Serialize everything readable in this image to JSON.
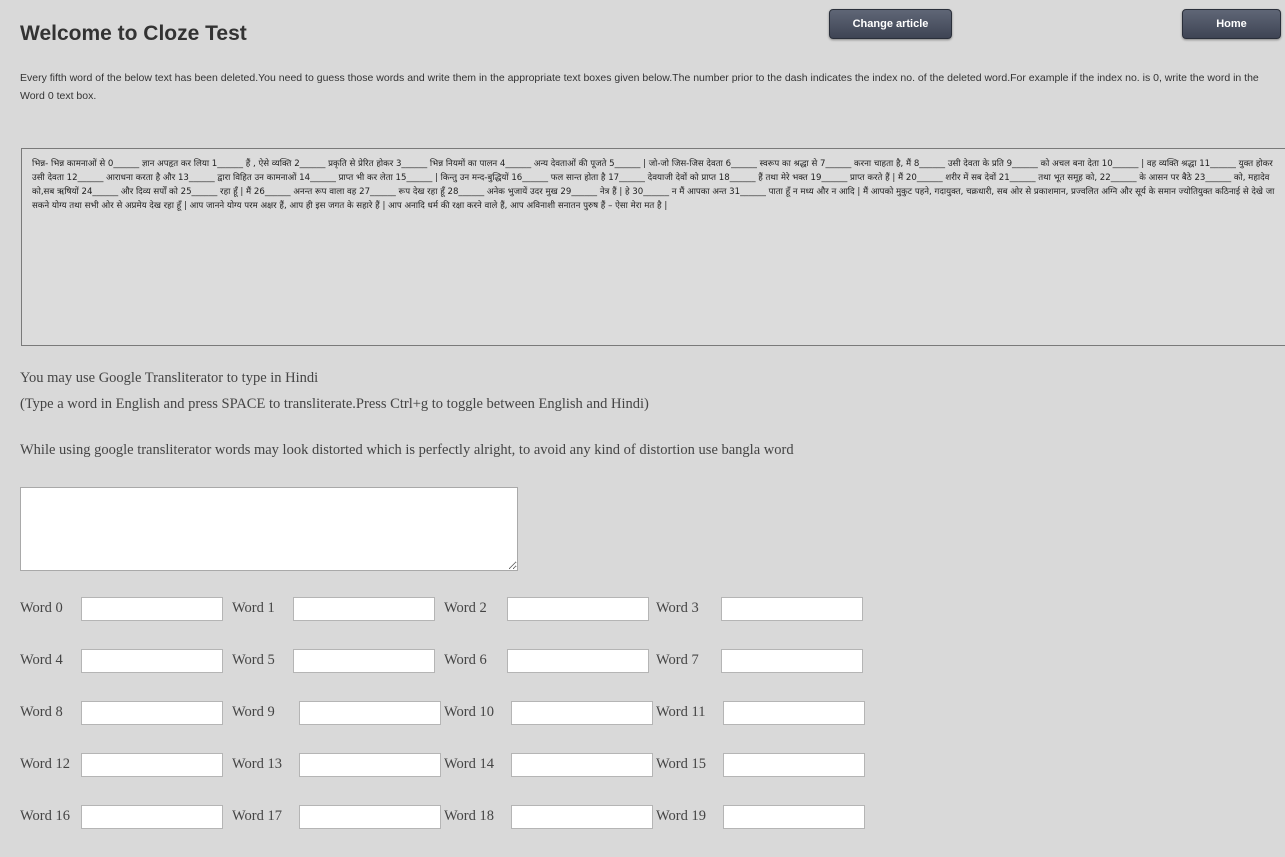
{
  "header": {
    "title": "Welcome to Cloze Test",
    "change_article_label": "Change article",
    "home_label": "Home"
  },
  "instructions": "Every fifth word of the below text has been deleted.You need to guess those words and write them in the appropriate text boxes given below.The number prior to the dash indicates the index no. of the deleted word.For example if the index no. is 0, write the word in the Word 0 text box.",
  "article": "भिन्न- भिन्न कामनाओं से 0______ ज्ञान अपहृत कर लिया 1______ हैं , ऐसे व्यक्ति 2______ प्रकृति से प्रेरित होकर 3______ भिन्न नियमों का पालन 4______ अन्य देवताओं की पूजते 5______ | जो-जो जिस-जिस देवता 6______ स्वरूप का श्रद्धा से 7______ करना चाहता है, मैं 8______ उसी देवता के प्रति 9______ को अचल बना देता 10______ | वह व्यक्ति श्रद्धा 11______ युक्त होकर उसी देवता 12______ आराधना करता है और 13______ द्वारा विहित उन कामनाओं 14______ प्राप्त भी कर लेता 15______ | किन्तु उन मन्द-बुद्धियों 16______ फल सान्त होता है 17______ देवयाजी देवों को प्राप्त 18______ हैं तथा मेरे भक्त 19______ प्राप्त करते हैं | मैं 20______ शरीर में सब देवों 21______ तथा भूत समूह को, 22______ के आसन पर बैठे 23______ को, महादेव को,सब ऋषियों 24______ और दिव्य सर्पों को 25______ रहा हूँ | मैं 26______ अनन्त रूप वाला वह 27______ रूप देख रहा हूँ 28______ अनेक भुजायें उदर मुख 29______ नेत्र हैं | हे 30______ न मैं आपका अन्त 31______ पाता हूँ न मध्य और न आदि | मैं आपको मुकुट पहने, गदायुक्त, चक्रधारी, सब ओर से प्रकाशमान, प्रज्वलित अग्नि और सूर्य के समान ज्योतियुक्त कठिनाई से देखे जा सकने योग्य तथा सभी ओर से अप्रमेय देख रहा हूँ | आप जानने योग्य परम अक्षर हैं, आप ही इस जगत के सहारे हैं | आप अनादि धर्म की रक्षा करने वाले हैं, आप अविनाशी सनातन पुरुष हैं – ऐसा मेरा मत है |",
  "transliteration": {
    "hint_line1": "You may use Google Transliterator to type in Hindi",
    "hint_line2": "(Type a word in English and press SPACE to transliterate.Press Ctrl+g to toggle between English and Hindi)",
    "hint_line3": "While using google transliterator words may look distorted which is perfectly alright, to avoid any kind of distortion use bangla word",
    "textarea_value": ""
  },
  "words": {
    "labels": [
      "Word 0",
      "Word 1",
      "Word 2",
      "Word 3",
      "Word 4",
      "Word 5",
      "Word 6",
      "Word 7",
      "Word 8",
      "Word 9",
      "Word 10",
      "Word 11",
      "Word 12",
      "Word 13",
      "Word 14",
      "Word 15",
      "Word 16",
      "Word 17",
      "Word 18",
      "Word 19"
    ],
    "values": [
      "",
      "",
      "",
      "",
      "",
      "",
      "",
      "",
      "",
      "",
      "",
      "",
      "",
      "",
      "",
      "",
      "",
      "",
      "",
      ""
    ]
  }
}
